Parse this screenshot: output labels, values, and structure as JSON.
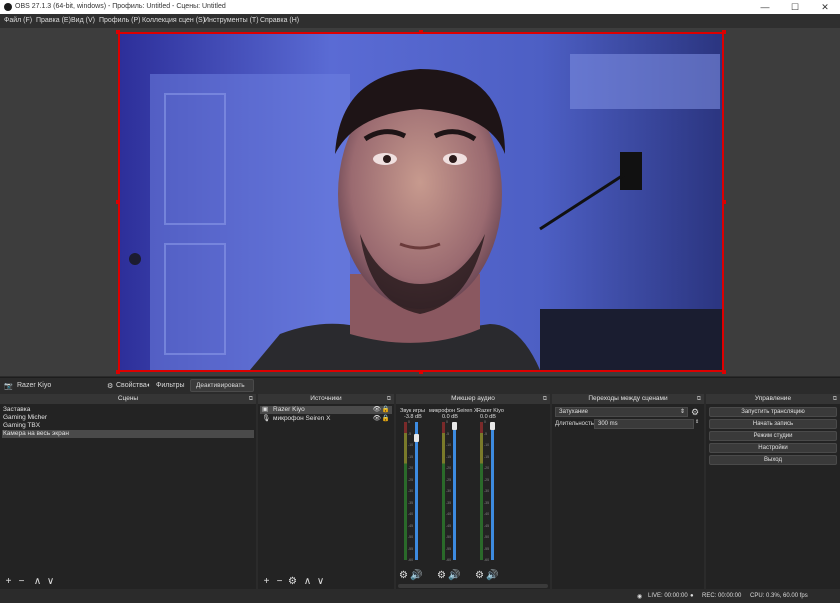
{
  "window": {
    "title": "OBS 27.1.3 (64-bit, windows) - Профиль: Untitled - Сцены: Untitled",
    "minimize": "—",
    "maximize": "☐",
    "close": "✕"
  },
  "menu": [
    "Файл (F)",
    "Правка (E)",
    "Вид (V)",
    "Профиль (P)",
    "Коллекция сцен (S)",
    "Инструменты (T)",
    "Справка (H)"
  ],
  "source_toolbar": {
    "source_name": "Razer Kiyo",
    "properties": "Свойства",
    "filters": "Фильтры",
    "deactivate": "Деактивировать"
  },
  "scenes": {
    "title": "Сцены",
    "items": [
      "Заставка",
      "Gaming Micher",
      "Gaming TBX",
      "Камера на весь экран"
    ],
    "selected_index": 3
  },
  "sources": {
    "title": "Источники",
    "items": [
      "Razer Kiyo",
      "микрофон Seiren X"
    ]
  },
  "mixer": {
    "title": "Микшер аудио",
    "channels": [
      {
        "name": "Звук игры",
        "db": "-3.8 dB",
        "level": 0.85
      },
      {
        "name": "микрофон Seiren X",
        "db": "0.0 dB",
        "level": 1.0
      },
      {
        "name": "Razer Kiyo",
        "db": "0.0 dB",
        "level": 1.0
      }
    ],
    "ticks": [
      "0",
      "-5",
      "-10",
      "-15",
      "-20",
      "-25",
      "-30",
      "-35",
      "-40",
      "-45",
      "-50",
      "-55",
      "-60"
    ]
  },
  "transitions": {
    "title": "Переходы между сценами",
    "selected": "Затухание",
    "duration_label": "Длительность",
    "duration_value": "300 ms"
  },
  "controls": {
    "title": "Управление",
    "buttons": [
      "Запустить трансляцию",
      "Начать запись",
      "Режим студии",
      "Настройки",
      "Выход"
    ]
  },
  "status": {
    "live": "LIVE: 00:00:00",
    "rec": "REC: 00:00:00",
    "cpu": "CPU: 0.3%, 60.00 fps"
  },
  "colors": {
    "selection_border": "#dd0000",
    "volume_slider": "#3d8be0"
  }
}
